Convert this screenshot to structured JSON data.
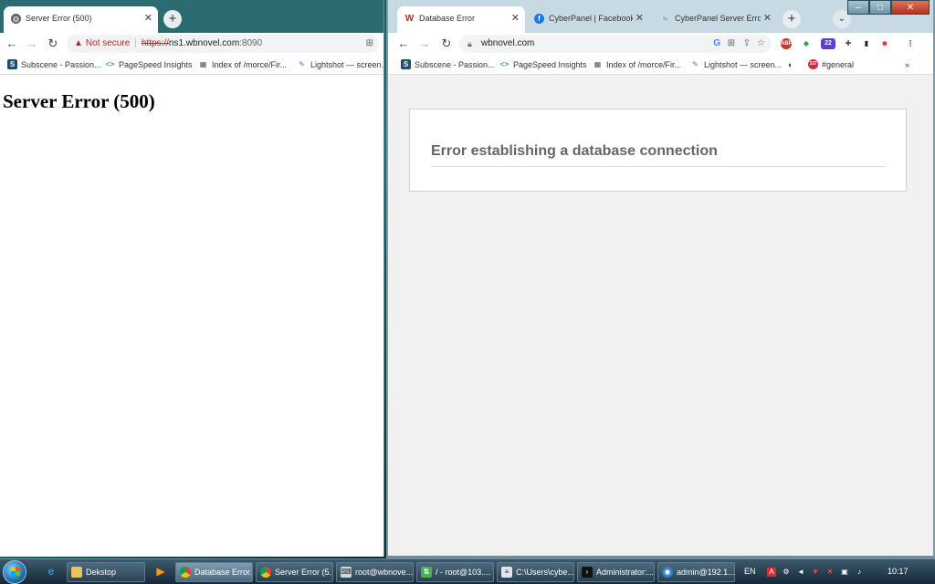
{
  "left_window": {
    "tab": {
      "title": "Server Error (500)"
    },
    "address": {
      "security_label": "Not secure",
      "scheme": "https://",
      "host": "ns1.wbnovel.com",
      "port": ":8090"
    },
    "bookmarks": [
      {
        "label": "Subscene - Passion...",
        "icon": "S"
      },
      {
        "label": "PageSpeed Insights",
        "icon": "<>"
      },
      {
        "label": "Index of /morce/Fir...",
        "icon": "▦"
      },
      {
        "label": "Lightshot — screen...",
        "icon": "✎"
      }
    ],
    "heading": "Server Error (500)"
  },
  "right_window": {
    "tabs": [
      {
        "title": "Database Error",
        "icon": "W"
      },
      {
        "title": "CyberPanel | Facebook",
        "icon": "f"
      },
      {
        "title": "CyberPanel Server Error",
        "icon": "∿"
      }
    ],
    "address": {
      "url": "wbnovel.com"
    },
    "bookmarks": [
      {
        "label": "Subscene - Passion...",
        "icon": "S"
      },
      {
        "label": "PageSpeed Insights",
        "icon": "<>"
      },
      {
        "label": "Index of /morce/Fir...",
        "icon": "▦"
      },
      {
        "label": "Lightshot — screen...",
        "icon": "✎"
      },
      {
        "label": "#general",
        "icon": "337"
      }
    ],
    "extension_badge": "22",
    "error_message": "Error establishing a database connection"
  },
  "taskbar": {
    "items": [
      {
        "label": "Dekstop",
        "icon": "folder-icon"
      },
      {
        "label": "Database Error...",
        "icon": "chrome-icon"
      },
      {
        "label": "Server Error (5...",
        "icon": "chrome-icon"
      },
      {
        "label": "root@wbnove...",
        "icon": "putty-icon"
      },
      {
        "label": "/ - root@103....",
        "icon": "winscp-icon"
      },
      {
        "label": "C:\\Users\\cybe...",
        "icon": "notepad-icon"
      },
      {
        "label": "Administrator:...",
        "icon": "cmd-icon"
      },
      {
        "label": "admin@192.1...",
        "icon": "remote-icon"
      }
    ],
    "language": "EN",
    "clock": "10:17"
  },
  "colors": {
    "error_red": "#c5221f",
    "facebook_blue": "#1877f2",
    "desktop_teal": "#1d6b6b"
  }
}
